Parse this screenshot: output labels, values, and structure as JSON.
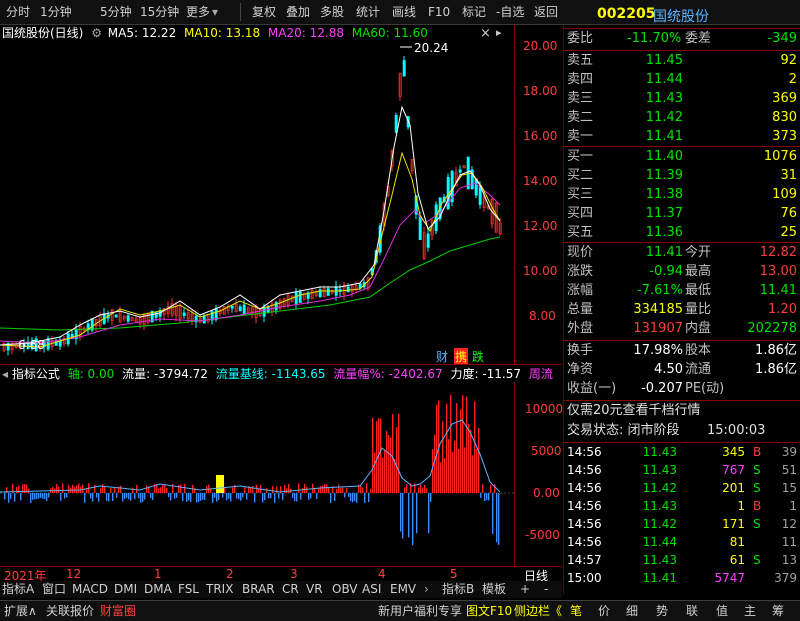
{
  "toolbar": {
    "left_items": [
      "分时",
      "1分钟",
      "5分钟",
      "15分钟",
      "更多"
    ],
    "right_items": [
      "复权",
      "叠加",
      "多股",
      "统计",
      "画线",
      "F10",
      "标记",
      "-自选",
      "返回"
    ]
  },
  "chart_header": {
    "name": "国统股份(日线)",
    "ma5": "MA5: 12.22",
    "ma10": "MA10: 13.18",
    "ma20": "MA20: 12.88",
    "ma60": "MA60: 11.60"
  },
  "price_axis": [
    "20.00",
    "18.00",
    "16.00",
    "14.00",
    "12.00",
    "10.00",
    "8.00"
  ],
  "annotations": {
    "high": "20.24",
    "low": "6.68"
  },
  "badges": [
    "财",
    "携",
    "跌"
  ],
  "indicator_header": {
    "title": "指标公式",
    "axis": "轴: 0.00",
    "flow": "流量: -3794.72",
    "baseline": "流量基线: -1143.65",
    "amp": "流量幅%: -2402.67",
    "force": "力度: -11.57",
    "extra": "周流"
  },
  "indicator_axis": [
    "10000",
    "5000",
    "0.00",
    "-5000"
  ],
  "time_axis": {
    "labels": [
      "2021年",
      "12",
      "1",
      "2",
      "3",
      "4",
      "5"
    ],
    "right": "日线"
  },
  "indicator_tabs": [
    "指标A",
    "窗口",
    "MACD",
    "DMI",
    "DMA",
    "FSL",
    "TRIX",
    "BRAR",
    "CR",
    "VR",
    "OBV",
    "ASI",
    "EMV",
    "指标B",
    "模板",
    "+",
    "-"
  ],
  "bottombar": {
    "left": [
      "扩展∧",
      "关联报价",
      "财富圈"
    ],
    "middle": [
      "新用户福利专享",
      "图文F10",
      "侧边栏《"
    ],
    "right": [
      "笔",
      "价",
      "细",
      "势",
      "联",
      "值",
      "主",
      "筹"
    ]
  },
  "quote": {
    "code": "002205",
    "name": "国统股份",
    "ratio_label": "委比",
    "ratio": "-11.70%",
    "diff_label": "委差",
    "diff": "-349",
    "asks": [
      {
        "label": "卖五",
        "price": "11.45",
        "vol": "92"
      },
      {
        "label": "卖四",
        "price": "11.44",
        "vol": "2"
      },
      {
        "label": "卖三",
        "price": "11.43",
        "vol": "369"
      },
      {
        "label": "卖二",
        "price": "11.42",
        "vol": "830"
      },
      {
        "label": "卖一",
        "price": "11.41",
        "vol": "373"
      }
    ],
    "bids": [
      {
        "label": "买一",
        "price": "11.40",
        "vol": "1076"
      },
      {
        "label": "买二",
        "price": "11.39",
        "vol": "31"
      },
      {
        "label": "买三",
        "price": "11.38",
        "vol": "109"
      },
      {
        "label": "买四",
        "price": "11.37",
        "vol": "76"
      },
      {
        "label": "买五",
        "price": "11.36",
        "vol": "25"
      }
    ],
    "stats": [
      {
        "l1": "现价",
        "v1": "11.41",
        "c1": "grn",
        "l2": "今开",
        "v2": "12.82",
        "c2": "red"
      },
      {
        "l1": "涨跌",
        "v1": "-0.94",
        "c1": "grn",
        "l2": "最高",
        "v2": "13.00",
        "c2": "red"
      },
      {
        "l1": "涨幅",
        "v1": "-7.61%",
        "c1": "grn",
        "l2": "最低",
        "v2": "11.41",
        "c2": "grn"
      },
      {
        "l1": "总量",
        "v1": "334185",
        "c1": "yel",
        "l2": "量比",
        "v2": "1.20",
        "c2": "red"
      },
      {
        "l1": "外盘",
        "v1": "131907",
        "c1": "red",
        "l2": "内盘",
        "v2": "202278",
        "c2": "grn"
      }
    ],
    "stats2": [
      {
        "l1": "换手",
        "v1": "17.98%",
        "l2": "股本",
        "v2": "1.86亿"
      },
      {
        "l1": "净资",
        "v1": "4.50",
        "l2": "流通",
        "v2": "1.86亿"
      },
      {
        "l1": "收益(一)",
        "v1": "-0.207",
        "l2": "PE(动)",
        "v2": ""
      }
    ],
    "promo": "仅需20元查看千档行情",
    "status": "交易状态: 闭市阶段",
    "status_time": "15:00:03",
    "ticks": [
      {
        "t": "14:56",
        "p": "11.43",
        "v": "345",
        "vc": "yel",
        "s": "B",
        "sc": "red",
        "n": "39"
      },
      {
        "t": "14:56",
        "p": "11.43",
        "v": "767",
        "vc": "mag",
        "s": "S",
        "sc": "grn",
        "n": "51"
      },
      {
        "t": "14:56",
        "p": "11.42",
        "v": "201",
        "vc": "yel",
        "s": "S",
        "sc": "grn",
        "n": "15"
      },
      {
        "t": "14:56",
        "p": "11.43",
        "v": "1",
        "vc": "yel",
        "s": "B",
        "sc": "red",
        "n": "1"
      },
      {
        "t": "14:56",
        "p": "11.42",
        "v": "171",
        "vc": "yel",
        "s": "S",
        "sc": "grn",
        "n": "12"
      },
      {
        "t": "14:56",
        "p": "11.44",
        "v": "81",
        "vc": "yel",
        "s": "",
        "sc": "grn",
        "n": "11"
      },
      {
        "t": "14:57",
        "p": "11.43",
        "v": "61",
        "vc": "yel",
        "s": "S",
        "sc": "grn",
        "n": "13"
      },
      {
        "t": "15:00",
        "p": "11.41",
        "v": "5747",
        "vc": "mag",
        "s": "",
        "sc": "grn",
        "n": "379"
      }
    ]
  }
}
